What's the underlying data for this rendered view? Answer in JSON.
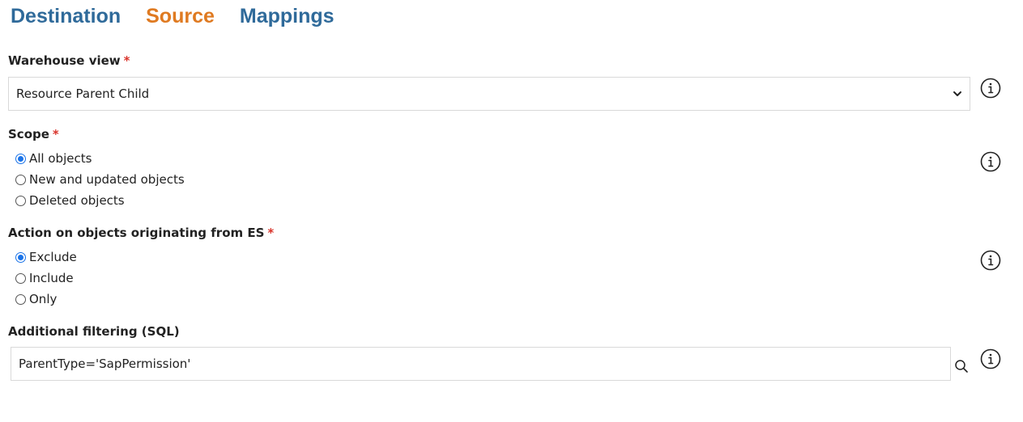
{
  "tabs": [
    {
      "label": "Destination",
      "active": false
    },
    {
      "label": "Source",
      "active": true
    },
    {
      "label": "Mappings",
      "active": false
    }
  ],
  "colors": {
    "tab": "#2f6a9a",
    "tab_active": "#df7a21",
    "required": "#d9342b",
    "radio_checked": "#1a73e8"
  },
  "warehouse_view": {
    "label": "Warehouse view",
    "required_marker": "*",
    "selected_value": "Resource Parent Child"
  },
  "scope": {
    "label": "Scope",
    "required_marker": "*",
    "options": [
      {
        "label": "All objects",
        "checked": true
      },
      {
        "label": "New and updated objects",
        "checked": false
      },
      {
        "label": "Deleted objects",
        "checked": false
      }
    ]
  },
  "action_es": {
    "label": "Action on objects originating from ES",
    "required_marker": "*",
    "options": [
      {
        "label": "Exclude",
        "checked": true
      },
      {
        "label": "Include",
        "checked": false
      },
      {
        "label": "Only",
        "checked": false
      }
    ]
  },
  "additional_filtering": {
    "label": "Additional filtering (SQL)",
    "value": "ParentType='SapPermission'"
  },
  "icons": {
    "info": "info-icon",
    "search": "search-icon",
    "chevron": "chevron-down-icon"
  }
}
